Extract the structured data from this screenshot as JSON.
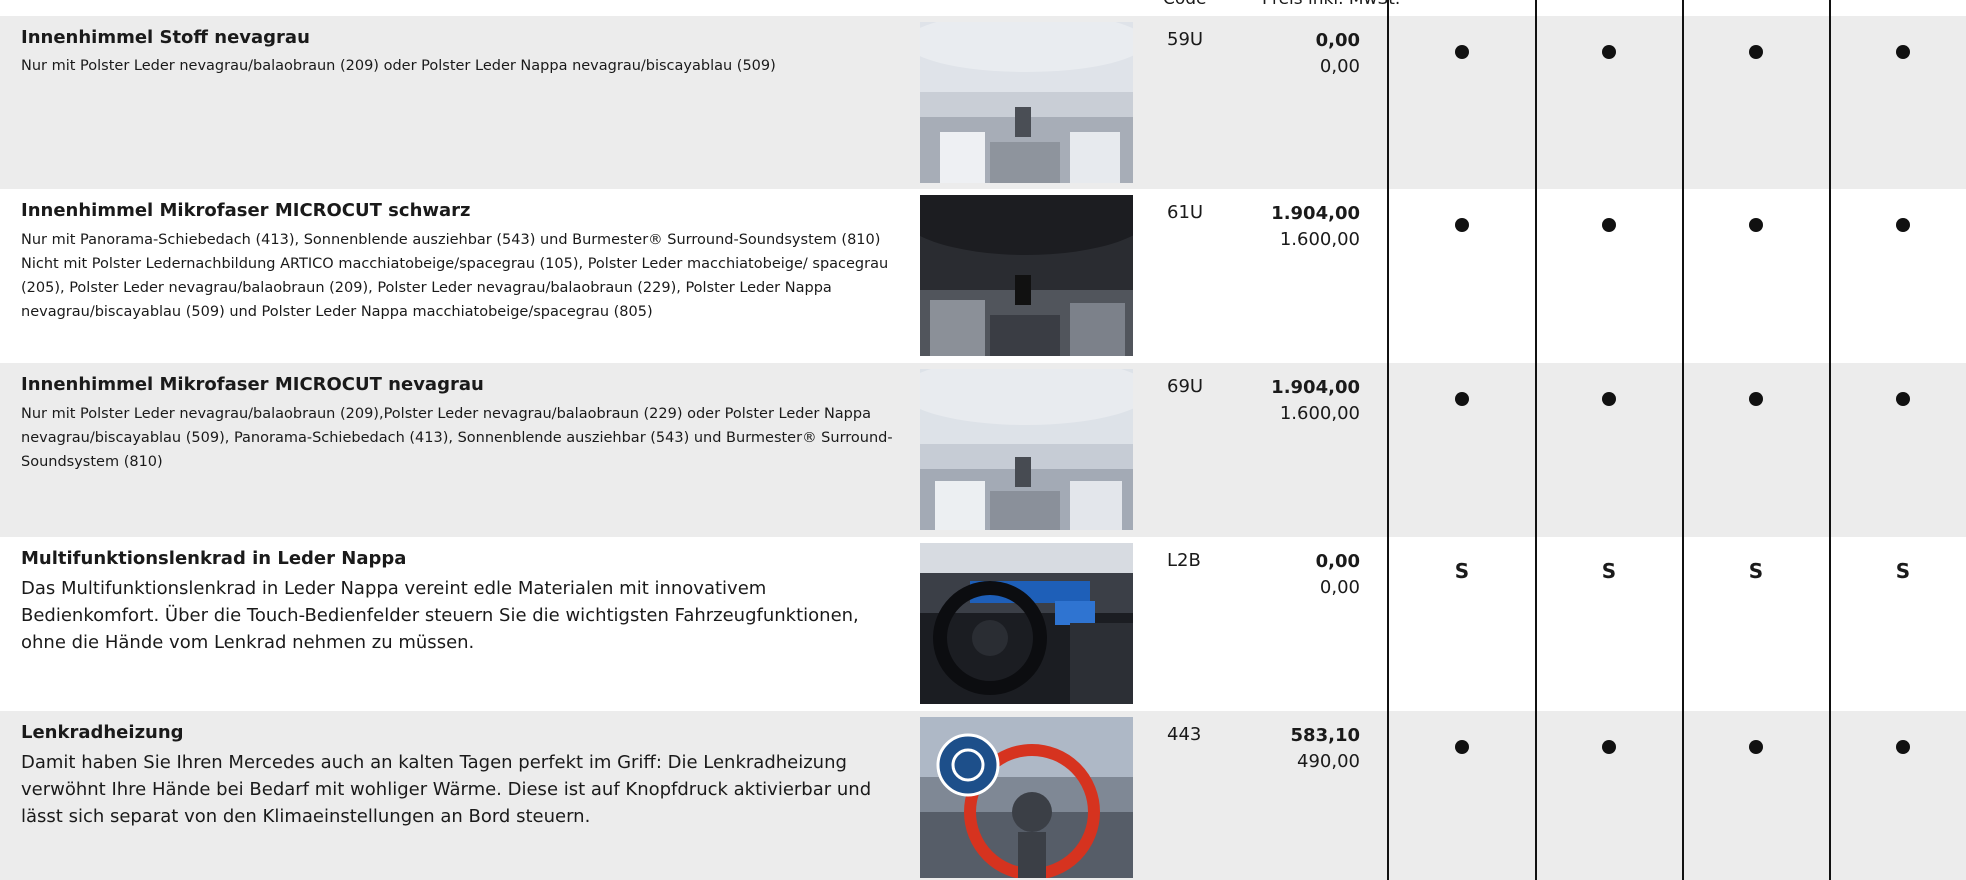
{
  "header": {
    "code_label": "Code",
    "price_label": "Preis inkl. MwSt."
  },
  "rows": [
    {
      "title": "Innenhimmel Stoff nevagrau",
      "desc": [
        "Nur mit Polster Leder nevagrau/balaobraun (209) oder Polster Leder Nappa nevagrau/biscayablau (509)"
      ],
      "image": "headliner-grey-interior-image",
      "code": "59U",
      "price_gross": "0,00",
      "price_net": "0,00",
      "marks": [
        "dot",
        "dot",
        "dot",
        "dot"
      ]
    },
    {
      "title": "Innenhimmel Mikrofaser MICROCUT schwarz",
      "desc": [
        "Nur mit Panorama-Schiebedach (413), Sonnenblende ausziehbar (543) und Burmester® Surround-Soundsystem (810)",
        "Nicht mit Polster Ledernachbildung ARTICO macchiatobeige/spacegrau (105), Polster Leder macchiatobeige/ spacegrau (205), Polster Leder nevagrau/balaobraun (209), Polster Leder nevagrau/balaobraun (229), Polster Leder Nappa nevagrau/biscayablau (509) und Polster Leder Nappa macchiatobeige/spacegrau (805)"
      ],
      "image": "headliner-black-interior-image",
      "code": "61U",
      "price_gross": "1.904,00",
      "price_net": "1.600,00",
      "marks": [
        "dot",
        "dot",
        "dot",
        "dot"
      ]
    },
    {
      "title": "Innenhimmel Mikrofaser MICROCUT nevagrau",
      "desc": [
        "Nur mit Polster Leder nevagrau/balaobraun (209),Polster Leder nevagrau/balaobraun (229) oder Polster Leder Nappa nevagrau/biscayablau (509), Panorama-Schiebedach (413), Sonnenblende ausziehbar (543) und Burmester® Surround-Soundsystem (810)"
      ],
      "image": "headliner-grey-interior-image",
      "code": "69U",
      "price_gross": "1.904,00",
      "price_net": "1.600,00",
      "marks": [
        "dot",
        "dot",
        "dot",
        "dot"
      ]
    },
    {
      "title": "Multifunktionslenkrad in Leder Nappa",
      "desc": [
        "Das Multifunktionslenkrad in Leder Nappa vereint edle Materialen mit innovativem Bedienkomfort. Über die Touch-Bedienfelder steuern Sie die wichtigsten Fahrzeugfunktionen, ohne die Hände vom Lenkrad nehmen zu müssen."
      ],
      "image": "steering-wheel-cockpit-image",
      "code": "L2B",
      "price_gross": "0,00",
      "price_net": "0,00",
      "marks": [
        "S",
        "S",
        "S",
        "S"
      ]
    },
    {
      "title": "Lenkradheizung",
      "desc": [
        "Damit haben Sie Ihren Mercedes auch an kalten Tagen perfekt im Griff: Die Lenkradheizung verwöhnt Ihre Hände bei Bedarf mit wohliger Wärme. Diese ist auf Knopfdruck aktivierbar und lässt sich separat von den Klimaeinstellungen an Bord steuern."
      ],
      "image": "steering-wheel-heating-image",
      "code": "443",
      "price_gross": "583,10",
      "price_net": "490,00",
      "marks": [
        "dot",
        "dot",
        "dot",
        "dot"
      ]
    }
  ],
  "colors": {
    "row_grey": "#ececec",
    "row_white": "#ffffff",
    "text": "#1a1a1a",
    "heating_ring": "#d6331f"
  }
}
